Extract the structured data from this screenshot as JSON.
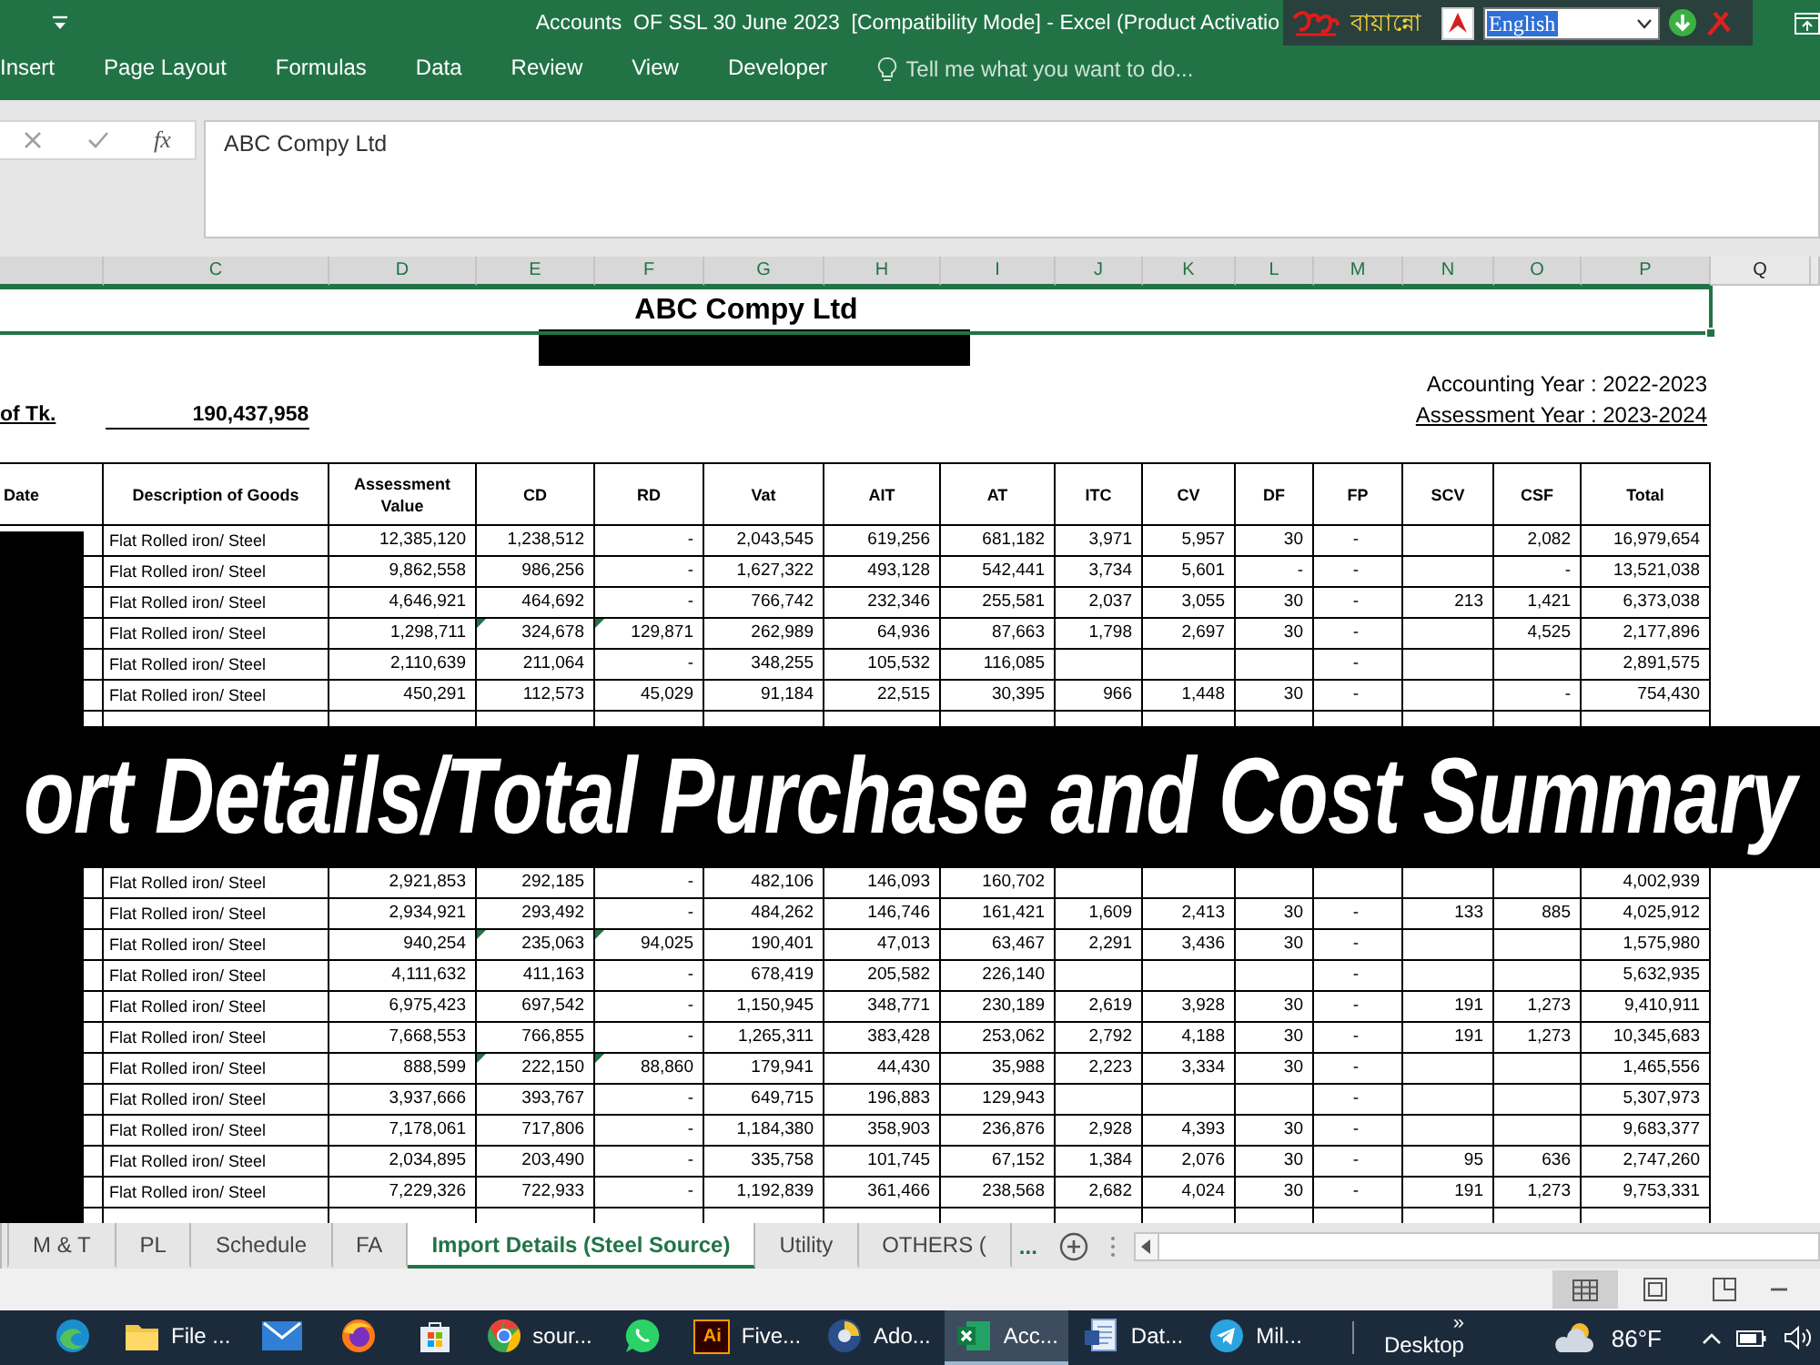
{
  "window": {
    "title": "Accounts  OF SSL 30 June 2023  [Compatibility Mode] - Excel (Product Activatio"
  },
  "keyboard_toolbar": {
    "brand": "বায়ান্নো",
    "language": "English"
  },
  "ribbon": {
    "tabs": [
      {
        "label": "Insert",
        "selected": false
      },
      {
        "label": "Page Layout",
        "selected": false
      },
      {
        "label": "Formulas",
        "selected": false
      },
      {
        "label": "Data",
        "selected": false
      },
      {
        "label": "Review",
        "selected": false
      },
      {
        "label": "View",
        "selected": false
      },
      {
        "label": "Developer",
        "selected": false
      }
    ],
    "tell_me": {
      "placeholder": "Tell me what you want to do..."
    }
  },
  "formula_bar": {
    "function_button": "fx",
    "value": "ABC Compy Ltd"
  },
  "column_headers": [
    {
      "label": "C",
      "selected": true
    },
    {
      "label": "D",
      "selected": true
    },
    {
      "label": "E",
      "selected": true
    },
    {
      "label": "F",
      "selected": true
    },
    {
      "label": "G",
      "selected": true
    },
    {
      "label": "H",
      "selected": true
    },
    {
      "label": "I",
      "selected": true
    },
    {
      "label": "J",
      "selected": true
    },
    {
      "label": "K",
      "selected": true
    },
    {
      "label": "L",
      "selected": true
    },
    {
      "label": "M",
      "selected": true
    },
    {
      "label": "N",
      "selected": true
    },
    {
      "label": "O",
      "selected": true
    },
    {
      "label": "P",
      "selected": true
    },
    {
      "label": "Q",
      "selected": false
    }
  ],
  "sheet": {
    "title_cell": {
      "text": "ABC Compy Ltd",
      "selected": true
    },
    "accounting_year": "Accounting Year : 2022-2023",
    "amount_label": "of Tk.",
    "amount": "190,437,958",
    "assessment_year": "Assessment Year : 2023-2024"
  },
  "table": {
    "columns": [
      "Date",
      "Description of Goods",
      "Assessment Value",
      "CD",
      "RD",
      "Vat",
      "AIT",
      "AT",
      "ITC",
      "CV",
      "DF",
      "FP",
      "SCV",
      "CSF",
      "Total"
    ],
    "rows_before_banner": [
      {
        "cells": [
          {
            "text": "Flat Rolled iron/ Steel",
            "error_mark": false
          },
          {
            "text": "12,385,120",
            "error_mark": false
          },
          {
            "text": "1,238,512",
            "error_mark": false
          },
          {
            "text": "-",
            "error_mark": false
          },
          {
            "text": "2,043,545",
            "error_mark": false
          },
          {
            "text": "619,256",
            "error_mark": false
          },
          {
            "text": "681,182",
            "error_mark": false
          },
          {
            "text": "3,971",
            "error_mark": false
          },
          {
            "text": "5,957",
            "error_mark": false
          },
          {
            "text": "30",
            "error_mark": false
          },
          {
            "text": "-",
            "error_mark": false
          },
          null,
          {
            "text": "2,082",
            "error_mark": false
          },
          {
            "text": "16,979,654",
            "error_mark": false
          }
        ]
      },
      {
        "cells": [
          {
            "text": "Flat Rolled iron/ Steel",
            "error_mark": false
          },
          {
            "text": "9,862,558",
            "error_mark": false
          },
          {
            "text": "986,256",
            "error_mark": false
          },
          {
            "text": "-",
            "error_mark": false
          },
          {
            "text": "1,627,322",
            "error_mark": false
          },
          {
            "text": "493,128",
            "error_mark": false
          },
          {
            "text": "542,441",
            "error_mark": false
          },
          {
            "text": "3,734",
            "error_mark": false
          },
          {
            "text": "5,601",
            "error_mark": false
          },
          {
            "text": "-",
            "error_mark": false
          },
          {
            "text": "-",
            "error_mark": false
          },
          null,
          {
            "text": "-",
            "error_mark": false
          },
          {
            "text": "13,521,038",
            "error_mark": false
          }
        ]
      },
      {
        "cells": [
          {
            "text": "Flat Rolled iron/ Steel",
            "error_mark": false
          },
          {
            "text": "4,646,921",
            "error_mark": false
          },
          {
            "text": "464,692",
            "error_mark": false
          },
          {
            "text": "-",
            "error_mark": false
          },
          {
            "text": "766,742",
            "error_mark": false
          },
          {
            "text": "232,346",
            "error_mark": false
          },
          {
            "text": "255,581",
            "error_mark": false
          },
          {
            "text": "2,037",
            "error_mark": false
          },
          {
            "text": "3,055",
            "error_mark": false
          },
          {
            "text": "30",
            "error_mark": false
          },
          {
            "text": "-",
            "error_mark": false
          },
          {
            "text": "213",
            "error_mark": false
          },
          {
            "text": "1,421",
            "error_mark": false
          },
          {
            "text": "6,373,038",
            "error_mark": false
          }
        ]
      },
      {
        "cells": [
          {
            "text": "Flat Rolled iron/ Steel",
            "error_mark": false
          },
          {
            "text": "1,298,711",
            "error_mark": false
          },
          {
            "text": "324,678",
            "error_mark": true
          },
          {
            "text": "129,871",
            "error_mark": true
          },
          {
            "text": "262,989",
            "error_mark": false
          },
          {
            "text": "64,936",
            "error_mark": false
          },
          {
            "text": "87,663",
            "error_mark": false
          },
          {
            "text": "1,798",
            "error_mark": false
          },
          {
            "text": "2,697",
            "error_mark": false
          },
          {
            "text": "30",
            "error_mark": false
          },
          {
            "text": "-",
            "error_mark": false
          },
          null,
          {
            "text": "4,525",
            "error_mark": false
          },
          {
            "text": "2,177,896",
            "error_mark": false
          }
        ]
      },
      {
        "cells": [
          {
            "text": "Flat Rolled iron/ Steel",
            "error_mark": false
          },
          {
            "text": "2,110,639",
            "error_mark": false
          },
          {
            "text": "211,064",
            "error_mark": false
          },
          {
            "text": "-",
            "error_mark": false
          },
          {
            "text": "348,255",
            "error_mark": false
          },
          {
            "text": "105,532",
            "error_mark": false
          },
          {
            "text": "116,085",
            "error_mark": false
          },
          null,
          null,
          null,
          {
            "text": "-",
            "error_mark": false
          },
          null,
          null,
          {
            "text": "2,891,575",
            "error_mark": false
          }
        ]
      },
      {
        "cells": [
          {
            "text": "Flat Rolled iron/ Steel",
            "error_mark": false
          },
          {
            "text": "450,291",
            "error_mark": false
          },
          {
            "text": "112,573",
            "error_mark": false
          },
          {
            "text": "45,029",
            "error_mark": false
          },
          {
            "text": "91,184",
            "error_mark": false
          },
          {
            "text": "22,515",
            "error_mark": false
          },
          {
            "text": "30,395",
            "error_mark": false
          },
          {
            "text": "966",
            "error_mark": false
          },
          {
            "text": "1,448",
            "error_mark": false
          },
          {
            "text": "30",
            "error_mark": false
          },
          {
            "text": "-",
            "error_mark": false
          },
          null,
          {
            "text": "-",
            "error_mark": false
          },
          {
            "text": "754,430",
            "error_mark": false
          }
        ]
      }
    ],
    "rows_after_banner": [
      {
        "cells": [
          {
            "text": "Flat Rolled iron/ Steel",
            "error_mark": false
          },
          {
            "text": "2,921,853",
            "error_mark": false
          },
          {
            "text": "292,185",
            "error_mark": false
          },
          {
            "text": "-",
            "error_mark": false
          },
          {
            "text": "482,106",
            "error_mark": false
          },
          {
            "text": "146,093",
            "error_mark": false
          },
          {
            "text": "160,702",
            "error_mark": false
          },
          null,
          null,
          null,
          null,
          null,
          null,
          {
            "text": "4,002,939",
            "error_mark": false
          }
        ]
      },
      {
        "cells": [
          {
            "text": "Flat Rolled iron/ Steel",
            "error_mark": false
          },
          {
            "text": "2,934,921",
            "error_mark": false
          },
          {
            "text": "293,492",
            "error_mark": false
          },
          {
            "text": "-",
            "error_mark": false
          },
          {
            "text": "484,262",
            "error_mark": false
          },
          {
            "text": "146,746",
            "error_mark": false
          },
          {
            "text": "161,421",
            "error_mark": false
          },
          {
            "text": "1,609",
            "error_mark": false
          },
          {
            "text": "2,413",
            "error_mark": false
          },
          {
            "text": "30",
            "error_mark": false
          },
          {
            "text": "-",
            "error_mark": false
          },
          {
            "text": "133",
            "error_mark": false
          },
          {
            "text": "885",
            "error_mark": false
          },
          {
            "text": "4,025,912",
            "error_mark": false
          }
        ]
      },
      {
        "cells": [
          {
            "text": "Flat Rolled iron/ Steel",
            "error_mark": false
          },
          {
            "text": "940,254",
            "error_mark": false
          },
          {
            "text": "235,063",
            "error_mark": true
          },
          {
            "text": "94,025",
            "error_mark": true
          },
          {
            "text": "190,401",
            "error_mark": false
          },
          {
            "text": "47,013",
            "error_mark": false
          },
          {
            "text": "63,467",
            "error_mark": false
          },
          {
            "text": "2,291",
            "error_mark": false
          },
          {
            "text": "3,436",
            "error_mark": false
          },
          {
            "text": "30",
            "error_mark": false
          },
          {
            "text": "-",
            "error_mark": false
          },
          null,
          null,
          {
            "text": "1,575,980",
            "error_mark": false
          }
        ]
      },
      {
        "cells": [
          {
            "text": "Flat Rolled iron/ Steel",
            "error_mark": false
          },
          {
            "text": "4,111,632",
            "error_mark": false
          },
          {
            "text": "411,163",
            "error_mark": false
          },
          {
            "text": "-",
            "error_mark": false
          },
          {
            "text": "678,419",
            "error_mark": false
          },
          {
            "text": "205,582",
            "error_mark": false
          },
          {
            "text": "226,140",
            "error_mark": false
          },
          null,
          null,
          null,
          {
            "text": "-",
            "error_mark": false
          },
          null,
          null,
          {
            "text": "5,632,935",
            "error_mark": false
          }
        ]
      },
      {
        "cells": [
          {
            "text": "Flat Rolled iron/ Steel",
            "error_mark": false
          },
          {
            "text": "6,975,423",
            "error_mark": false
          },
          {
            "text": "697,542",
            "error_mark": false
          },
          {
            "text": "-",
            "error_mark": false
          },
          {
            "text": "1,150,945",
            "error_mark": false
          },
          {
            "text": "348,771",
            "error_mark": false
          },
          {
            "text": "230,189",
            "error_mark": false
          },
          {
            "text": "2,619",
            "error_mark": false
          },
          {
            "text": "3,928",
            "error_mark": false
          },
          {
            "text": "30",
            "error_mark": false
          },
          {
            "text": "-",
            "error_mark": false
          },
          {
            "text": "191",
            "error_mark": false
          },
          {
            "text": "1,273",
            "error_mark": false
          },
          {
            "text": "9,410,911",
            "error_mark": false
          }
        ]
      },
      {
        "cells": [
          {
            "text": "Flat Rolled iron/ Steel",
            "error_mark": false
          },
          {
            "text": "7,668,553",
            "error_mark": false
          },
          {
            "text": "766,855",
            "error_mark": false
          },
          {
            "text": "-",
            "error_mark": false
          },
          {
            "text": "1,265,311",
            "error_mark": false
          },
          {
            "text": "383,428",
            "error_mark": false
          },
          {
            "text": "253,062",
            "error_mark": false
          },
          {
            "text": "2,792",
            "error_mark": false
          },
          {
            "text": "4,188",
            "error_mark": false
          },
          {
            "text": "30",
            "error_mark": false
          },
          {
            "text": "-",
            "error_mark": false
          },
          {
            "text": "191",
            "error_mark": false
          },
          {
            "text": "1,273",
            "error_mark": false
          },
          {
            "text": "10,345,683",
            "error_mark": false
          }
        ]
      },
      {
        "cells": [
          {
            "text": "Flat Rolled iron/ Steel",
            "error_mark": false
          },
          {
            "text": "888,599",
            "error_mark": false
          },
          {
            "text": "222,150",
            "error_mark": true
          },
          {
            "text": "88,860",
            "error_mark": true
          },
          {
            "text": "179,941",
            "error_mark": false
          },
          {
            "text": "44,430",
            "error_mark": false
          },
          {
            "text": "35,988",
            "error_mark": false
          },
          {
            "text": "2,223",
            "error_mark": false
          },
          {
            "text": "3,334",
            "error_mark": false
          },
          {
            "text": "30",
            "error_mark": false
          },
          {
            "text": "-",
            "error_mark": false
          },
          null,
          null,
          {
            "text": "1,465,556",
            "error_mark": false
          }
        ]
      },
      {
        "cells": [
          {
            "text": "Flat Rolled iron/ Steel",
            "error_mark": false
          },
          {
            "text": "3,937,666",
            "error_mark": false
          },
          {
            "text": "393,767",
            "error_mark": false
          },
          {
            "text": "-",
            "error_mark": false
          },
          {
            "text": "649,715",
            "error_mark": false
          },
          {
            "text": "196,883",
            "error_mark": false
          },
          {
            "text": "129,943",
            "error_mark": false
          },
          null,
          null,
          null,
          {
            "text": "-",
            "error_mark": false
          },
          null,
          null,
          {
            "text": "5,307,973",
            "error_mark": false
          }
        ]
      },
      {
        "cells": [
          {
            "text": "Flat Rolled iron/ Steel",
            "error_mark": false
          },
          {
            "text": "7,178,061",
            "error_mark": false
          },
          {
            "text": "717,806",
            "error_mark": false
          },
          {
            "text": "-",
            "error_mark": false
          },
          {
            "text": "1,184,380",
            "error_mark": false
          },
          {
            "text": "358,903",
            "error_mark": false
          },
          {
            "text": "236,876",
            "error_mark": false
          },
          {
            "text": "2,928",
            "error_mark": false
          },
          {
            "text": "4,393",
            "error_mark": false
          },
          {
            "text": "30",
            "error_mark": false
          },
          {
            "text": "-",
            "error_mark": false
          },
          null,
          null,
          {
            "text": "9,683,377",
            "error_mark": false
          }
        ]
      },
      {
        "cells": [
          {
            "text": "Flat Rolled iron/ Steel",
            "error_mark": false
          },
          {
            "text": "2,034,895",
            "error_mark": false
          },
          {
            "text": "203,490",
            "error_mark": false
          },
          {
            "text": "-",
            "error_mark": false
          },
          {
            "text": "335,758",
            "error_mark": false
          },
          {
            "text": "101,745",
            "error_mark": false
          },
          {
            "text": "67,152",
            "error_mark": false
          },
          {
            "text": "1,384",
            "error_mark": false
          },
          {
            "text": "2,076",
            "error_mark": false
          },
          {
            "text": "30",
            "error_mark": false
          },
          {
            "text": "-",
            "error_mark": false
          },
          {
            "text": "95",
            "error_mark": false
          },
          {
            "text": "636",
            "error_mark": false
          },
          {
            "text": "2,747,260",
            "error_mark": false
          }
        ]
      },
      {
        "cells": [
          {
            "text": "Flat Rolled iron/ Steel",
            "error_mark": false
          },
          {
            "text": "7,229,326",
            "error_mark": false
          },
          {
            "text": "722,933",
            "error_mark": false
          },
          {
            "text": "-",
            "error_mark": false
          },
          {
            "text": "1,192,839",
            "error_mark": false
          },
          {
            "text": "361,466",
            "error_mark": false
          },
          {
            "text": "238,568",
            "error_mark": false
          },
          {
            "text": "2,682",
            "error_mark": false
          },
          {
            "text": "4,024",
            "error_mark": false
          },
          {
            "text": "30",
            "error_mark": false
          },
          {
            "text": "-",
            "error_mark": false
          },
          {
            "text": "191",
            "error_mark": false
          },
          {
            "text": "1,273",
            "error_mark": false
          },
          {
            "text": "9,753,331",
            "error_mark": false
          }
        ]
      }
    ]
  },
  "banner": {
    "text": "ort Details/Total Purchase and Cost Summary"
  },
  "sheet_tabs": {
    "tabs": [
      {
        "label": "M & T",
        "selected": false
      },
      {
        "label": "PL",
        "selected": false
      },
      {
        "label": "Schedule",
        "selected": false
      },
      {
        "label": "FA",
        "selected": false
      },
      {
        "label": "Import Details (Steel Source)",
        "selected": true
      },
      {
        "label": "Utility",
        "selected": false
      },
      {
        "label": "OTHERS (",
        "selected": false
      }
    ],
    "more": "..."
  },
  "status_bar": {
    "views": [
      {
        "kind": "normal",
        "selected": true
      },
      {
        "kind": "page_layout",
        "selected": false
      },
      {
        "kind": "page_break",
        "selected": false
      }
    ]
  },
  "taskbar": {
    "items": [
      {
        "kind": "edge",
        "selected": false
      },
      {
        "kind": "explorer",
        "label": "File ...",
        "selected": false
      },
      {
        "kind": "mail",
        "selected": false
      },
      {
        "kind": "firefox",
        "selected": false
      },
      {
        "kind": "store",
        "selected": false
      },
      {
        "kind": "chrome",
        "label": "sour...",
        "selected": false
      },
      {
        "kind": "whatsapp",
        "selected": false
      },
      {
        "kind": "illustrator",
        "icon_text": "Ai",
        "label": "Five...",
        "selected": false
      },
      {
        "kind": "app",
        "label": "Ado...",
        "selected": false
      },
      {
        "kind": "excel",
        "label": "Acc...",
        "selected": true
      },
      {
        "kind": "word",
        "label": "Dat...",
        "selected": false
      },
      {
        "kind": "telegram",
        "label": "Mil...",
        "selected": false
      }
    ],
    "overflow": "»",
    "desktop": "Desktop",
    "temperature": "86°F"
  }
}
